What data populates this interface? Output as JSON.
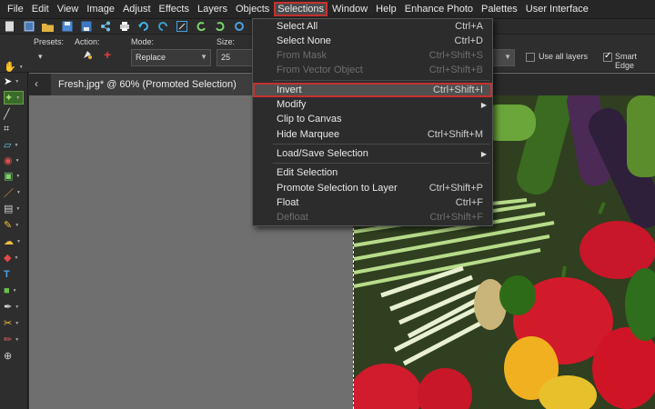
{
  "menubar": {
    "items": [
      "File",
      "Edit",
      "View",
      "Image",
      "Adjust",
      "Effects",
      "Layers",
      "Objects",
      "Selections",
      "Window",
      "Help",
      "Enhance Photo",
      "Palettes",
      "User Interface"
    ]
  },
  "options": {
    "presets_label": "Presets:",
    "action_label": "Action:",
    "mode_label": "Mode:",
    "mode_value": "Replace",
    "size_label": "Size:",
    "size_value": "25",
    "use_all_layers": "Use all layers",
    "smart_edge": "Smart Edge"
  },
  "document": {
    "tab_title": "Fresh.jpg* @  60% (Promoted Selection)"
  },
  "selections_menu": {
    "items": [
      {
        "label": "Select All",
        "shortcut": "Ctrl+A"
      },
      {
        "label": "Select None",
        "shortcut": "Ctrl+D"
      },
      {
        "label": "From Mask",
        "shortcut": "Ctrl+Shift+S"
      },
      {
        "label": "From Vector Object",
        "shortcut": "Ctrl+Shift+B"
      },
      {
        "label": "Invert",
        "shortcut": "Ctrl+Shift+I"
      },
      {
        "label": "Modify",
        "shortcut": ""
      },
      {
        "label": "Clip to Canvas",
        "shortcut": ""
      },
      {
        "label": "Hide Marquee",
        "shortcut": "Ctrl+Shift+M"
      },
      {
        "label": "Load/Save Selection",
        "shortcut": ""
      },
      {
        "label": "Edit Selection",
        "shortcut": ""
      },
      {
        "label": "Promote Selection to Layer",
        "shortcut": "Ctrl+Shift+P"
      },
      {
        "label": "Float",
        "shortcut": "Ctrl+F"
      },
      {
        "label": "Defloat",
        "shortcut": "Ctrl+Shift+F"
      }
    ]
  },
  "colors": {
    "highlight_outline": "#c8312e",
    "menu_bg": "#2c2c2c",
    "workspace_bg": "#6f6f6f"
  }
}
